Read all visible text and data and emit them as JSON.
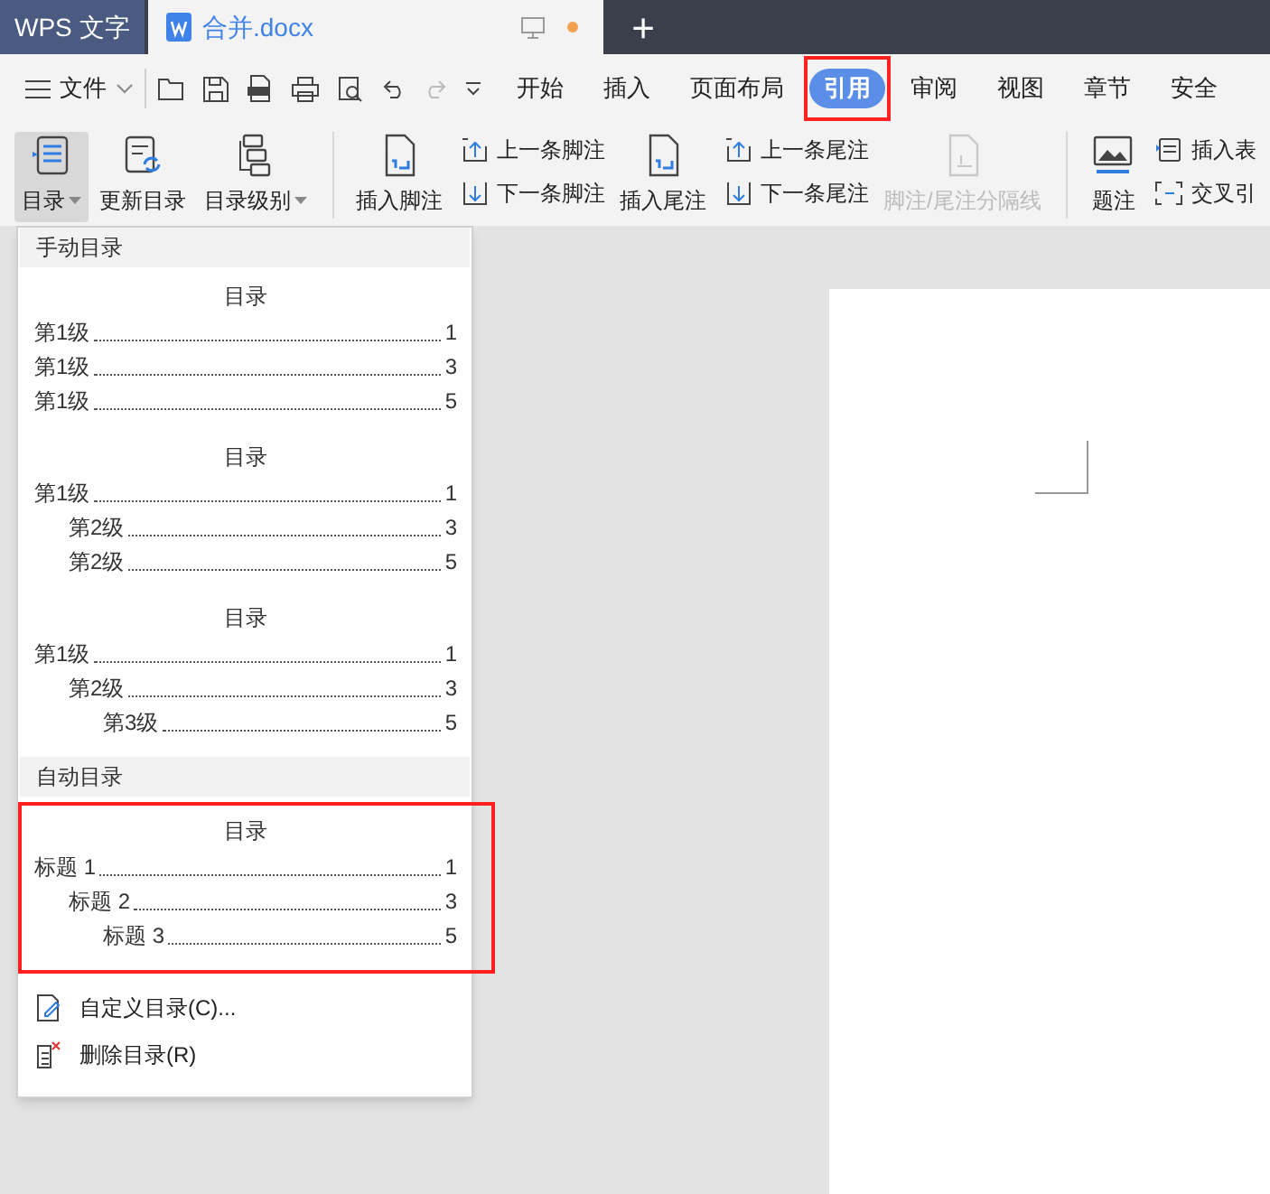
{
  "title_bar": {
    "app_tab": "WPS 文字",
    "doc_tab": {
      "title": "合并.docx",
      "modified": true
    },
    "new_tab": "+"
  },
  "menu_bar": {
    "file_menu": "文件",
    "tabs": [
      {
        "label": "开始",
        "selected": false,
        "highlighted": false
      },
      {
        "label": "插入",
        "selected": false,
        "highlighted": false
      },
      {
        "label": "页面布局",
        "selected": false,
        "highlighted": false
      },
      {
        "label": "引用",
        "selected": true,
        "highlighted": true
      },
      {
        "label": "审阅",
        "selected": false,
        "highlighted": false
      },
      {
        "label": "视图",
        "selected": false,
        "highlighted": false
      },
      {
        "label": "章节",
        "selected": false,
        "highlighted": false
      },
      {
        "label": "安全",
        "selected": false,
        "highlighted": false
      }
    ]
  },
  "ribbon": {
    "groups": [
      {
        "items": [
          {
            "kind": "large",
            "label": "目录",
            "dropdown": true,
            "selected": true,
            "disabled": false
          },
          {
            "kind": "large",
            "label": "更新目录",
            "dropdown": false,
            "selected": false,
            "disabled": false
          },
          {
            "kind": "large",
            "label": "目录级别",
            "dropdown": true,
            "selected": false,
            "disabled": false
          }
        ]
      },
      {
        "items": [
          {
            "kind": "large",
            "label": "插入脚注",
            "dropdown": false,
            "selected": false,
            "disabled": false
          },
          {
            "kind": "stack",
            "children": [
              {
                "label": "上一条脚注",
                "disabled": false
              },
              {
                "label": "下一条脚注",
                "disabled": false
              }
            ]
          },
          {
            "kind": "large",
            "label": "插入尾注",
            "dropdown": false,
            "selected": false,
            "disabled": false
          },
          {
            "kind": "stack",
            "children": [
              {
                "label": "上一条尾注",
                "disabled": false
              },
              {
                "label": "下一条尾注",
                "disabled": false
              }
            ]
          },
          {
            "kind": "large",
            "label": "脚注/尾注分隔线",
            "dropdown": false,
            "selected": false,
            "disabled": true
          }
        ]
      },
      {
        "items": [
          {
            "kind": "large",
            "label": "题注",
            "dropdown": false,
            "selected": false,
            "disabled": false
          },
          {
            "kind": "stack",
            "children": [
              {
                "label": "插入表",
                "disabled": false
              },
              {
                "label": "交叉引",
                "disabled": false
              }
            ]
          }
        ]
      }
    ]
  },
  "toc_menu": {
    "sections": [
      {
        "header": "手动目录",
        "highlighted": false,
        "tocs": [
          {
            "title": "目录",
            "entries": [
              {
                "label": "第1级",
                "page": "1"
              },
              {
                "label": "第1级",
                "page": "3"
              },
              {
                "label": "第1级",
                "page": "5"
              }
            ]
          },
          {
            "title": "目录",
            "entries": [
              {
                "label": "第1级",
                "page": "1",
                "children": [
                  {
                    "label": "第2级",
                    "page": "3"
                  },
                  {
                    "label": "第2级",
                    "page": "5"
                  }
                ]
              }
            ]
          },
          {
            "title": "目录",
            "entries": [
              {
                "label": "第1级",
                "page": "1",
                "children": [
                  {
                    "label": "第2级",
                    "page": "3",
                    "children": [
                      {
                        "label": "第3级",
                        "page": "5"
                      }
                    ]
                  }
                ]
              }
            ]
          }
        ]
      },
      {
        "header": "自动目录",
        "highlighted": true,
        "tocs": [
          {
            "title": "目录",
            "entries": [
              {
                "label": "标题 1",
                "page": "1",
                "children": [
                  {
                    "label": "标题 2",
                    "page": "3",
                    "children": [
                      {
                        "label": "标题 3",
                        "page": "5"
                      }
                    ]
                  }
                ]
              }
            ]
          }
        ]
      }
    ],
    "actions": [
      {
        "label": "自定义目录(C)..."
      },
      {
        "label": "删除目录(R)"
      }
    ]
  }
}
